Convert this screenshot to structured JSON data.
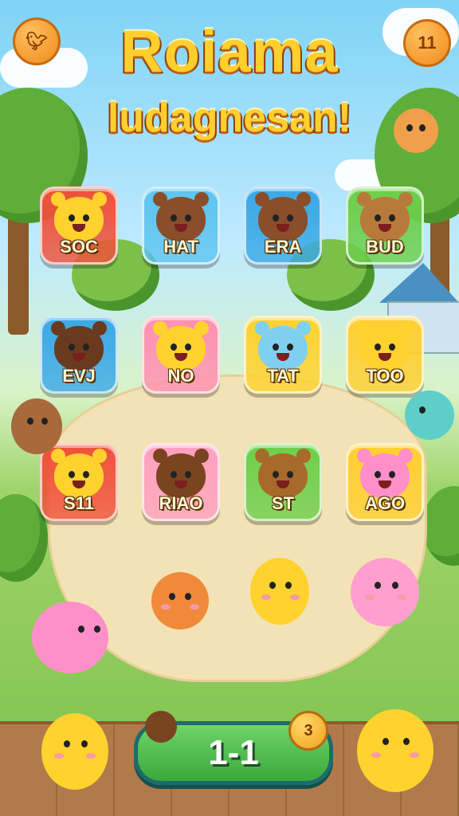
{
  "header": {
    "title_line1": "Roiama",
    "title_line2": "ludagnesan!",
    "left_icon": "bird-icon",
    "right_counter": "11"
  },
  "grid": {
    "tiles": [
      {
        "word": "SOC",
        "animal": "yellow-bear",
        "bg": "#f0503a",
        "face": "#ffd22e"
      },
      {
        "word": "HAT",
        "animal": "brown-bear",
        "bg": "#5ec4f0",
        "face": "#8a4e2a"
      },
      {
        "word": "ERA",
        "animal": "brown-bear",
        "bg": "#3aa8e6",
        "face": "#8a4e2a"
      },
      {
        "word": "BUD",
        "animal": "brown-fox",
        "bg": "#6ccf4a",
        "face": "#b87a3a"
      },
      {
        "word": "EVJ",
        "animal": "brown-bear",
        "bg": "#3aa8e6",
        "face": "#6a3a1e"
      },
      {
        "word": "NO",
        "animal": "yellow-bear",
        "bg": "#ff8fb0",
        "face": "#ffd22e"
      },
      {
        "word": "TAT",
        "animal": "blue-bear",
        "bg": "#ffd22e",
        "face": "#7fd0f0"
      },
      {
        "word": "TOO",
        "animal": "yellow-bear",
        "bg": "#ffcf2e",
        "face": "#ffd22e"
      },
      {
        "word": "S11",
        "animal": "yellow-bear",
        "bg": "#f0503a",
        "face": "#ffd22e"
      },
      {
        "word": "RIAO",
        "animal": "brown-bear",
        "bg": "#ff9fc0",
        "face": "#7a4420"
      },
      {
        "word": "ST",
        "animal": "brown-fox",
        "bg": "#6ccf4a",
        "face": "#a86a2a"
      },
      {
        "word": "AGO",
        "animal": "pink-cat",
        "bg": "#ffcf2e",
        "face": "#ff8fc8"
      }
    ]
  },
  "level": {
    "label": "1-1",
    "badge": "3"
  },
  "colors": {
    "title_fill": "#ffcf2e",
    "title_stroke": "#c0601a",
    "level_bar": "#3aa83a",
    "badge": "#f0a01a"
  }
}
